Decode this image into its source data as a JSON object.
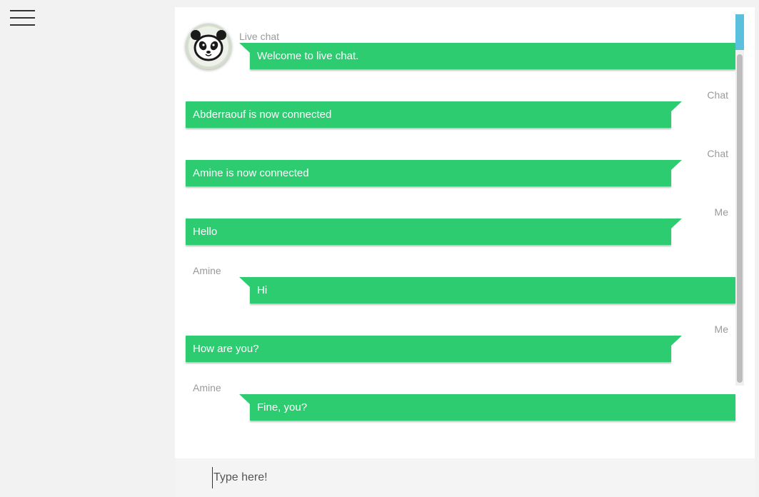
{
  "nav": {
    "menu_icon": "hamburger-menu-icon"
  },
  "chat": {
    "avatar_icon": "panda-avatar-icon",
    "colors": {
      "bubble": "#2ecc71",
      "bubble_text": "#ffffff",
      "sender": "#9a9a9a",
      "scroll_accent": "#5bc0de"
    },
    "messages": [
      {
        "sender": "Live chat",
        "text": "Welcome to live chat.",
        "direction": "in"
      },
      {
        "sender": "Chat",
        "text": "Abderraouf is now connected",
        "direction": "out"
      },
      {
        "sender": "Chat",
        "text": "Amine is now connected",
        "direction": "out"
      },
      {
        "sender": "Me",
        "text": "Hello",
        "direction": "out"
      },
      {
        "sender": "Amine",
        "text": "Hi",
        "direction": "in"
      },
      {
        "sender": "Me",
        "text": "How are you?",
        "direction": "out"
      },
      {
        "sender": "Amine",
        "text": "Fine, you?",
        "direction": "in"
      }
    ]
  },
  "composer": {
    "placeholder": "Type here!"
  }
}
